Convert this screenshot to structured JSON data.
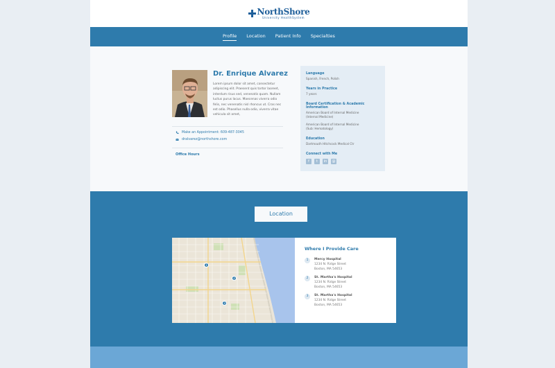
{
  "logo": {
    "name": "NorthShore",
    "sub": "University HealthSystem"
  },
  "nav": {
    "items": [
      {
        "label": "Profile"
      },
      {
        "label": "Location"
      },
      {
        "label": "Patient Info"
      },
      {
        "label": "Specialties"
      }
    ]
  },
  "profile": {
    "name": "Dr. Enrique Alvarez",
    "bio": "Lorem ipsum dolor sit amet, consectetur adipiscing elit. Praesent quis tortor laoreet, interdum risus sed, venenatis quam. Nullam luctus purus lacus. Maecenas viverra odio felis, nec venenatis nisl rhoncus ut. Cras nec est odio. Phasellus nulla odio, viverra vitae vehicula sit amet,",
    "phone": "Make an Appointment: 609-487-3045",
    "email": "dralvarez@northshore.com",
    "office_hours": "Office Hours"
  },
  "info": {
    "language_h": "Language",
    "language": "Spanish, French, Polish",
    "years_h": "Years in Practice",
    "years": "7 years",
    "cert_h": "Board Certification & Academic Information",
    "cert1a": "American Board of Internal Medicine",
    "cert1b": "(Internal Medicine)",
    "cert2a": "American Board of Internal Medicine",
    "cert2b": "(Sub: Hematology)",
    "edu_h": "Education",
    "edu": "Dartmouth Hitchcock Medical Ctr",
    "connect_h": "Connect with Me",
    "social": [
      "f",
      "t",
      "in",
      "@"
    ]
  },
  "location": {
    "button": "Location",
    "care_title": "Where I Provide Care",
    "hospitals": [
      {
        "num": "1",
        "name": "Mercy Hospital",
        "street": "1234 N. Ridge Street",
        "city": "Boston, MA 54653"
      },
      {
        "num": "2",
        "name": "St. Martha's Hospital",
        "street": "1234 N. Ridge Street",
        "city": "Boston, MA 54653"
      },
      {
        "num": "3",
        "name": "St. Martha's Hospital",
        "street": "1234 N. Ridge Street",
        "city": "Boston, MA 54653"
      }
    ]
  },
  "colors": {
    "brand": "#2e7bac",
    "panel": "#e4edf5",
    "footer": "#6ba7d6"
  }
}
